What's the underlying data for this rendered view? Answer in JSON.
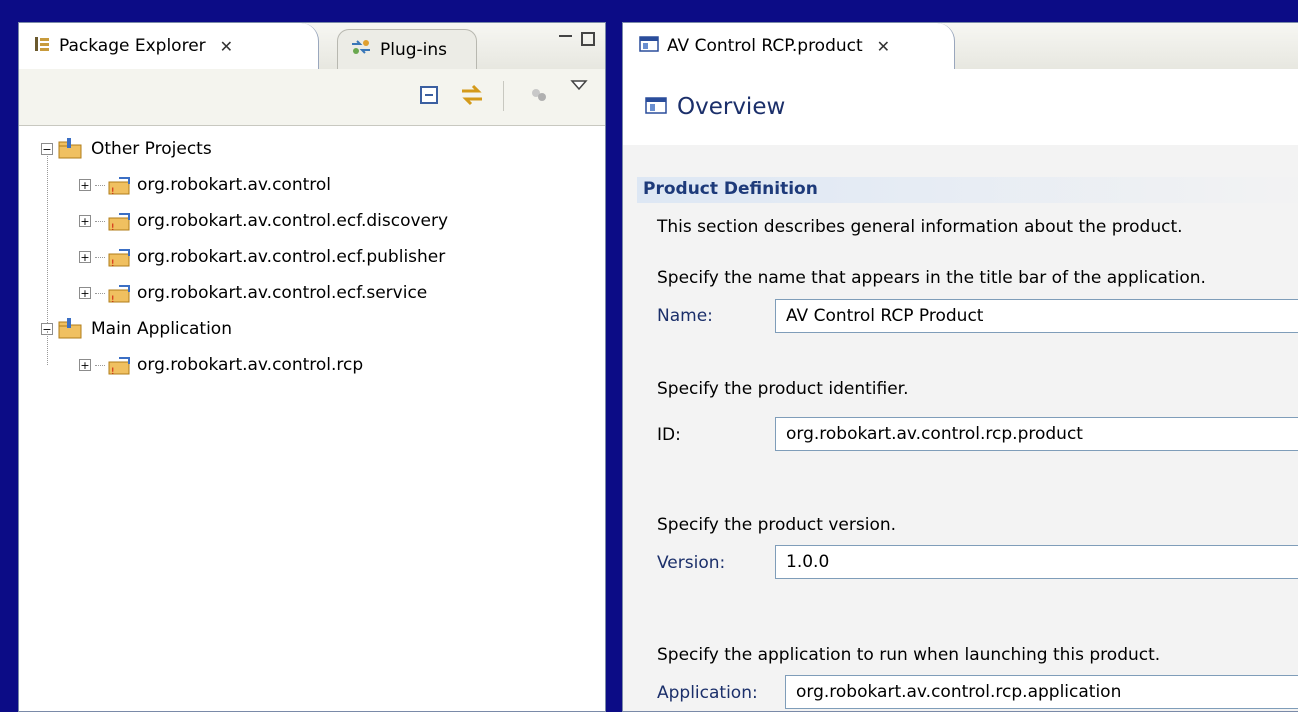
{
  "left_panel": {
    "tabs": [
      {
        "label": "Package Explorer",
        "close": "✕",
        "active": true
      },
      {
        "label": "Plug-ins",
        "active": false
      }
    ],
    "tree": {
      "groups": [
        {
          "label": "Other Projects",
          "children": [
            "org.robokart.av.control",
            "org.robokart.av.control.ecf.discovery",
            "org.robokart.av.control.ecf.publisher",
            "org.robokart.av.control.ecf.service"
          ]
        },
        {
          "label": "Main Application",
          "children": [
            "org.robokart.av.control.rcp"
          ]
        }
      ]
    }
  },
  "editor": {
    "tab": {
      "label": "AV Control RCP.product",
      "close": "✕"
    },
    "page_title": "Overview",
    "section": {
      "title": "Product Definition",
      "description": "This section describes general information about the product.",
      "name_hint": "Specify the name that appears in the title bar of the application.",
      "name_label": "Name:",
      "name_value": "AV Control RCP Product",
      "id_hint": "Specify the product identifier.",
      "id_label": "ID:",
      "id_value": "org.robokart.av.control.rcp.product",
      "version_hint": "Specify the product version.",
      "version_label": "Version:",
      "version_value": "1.0.0",
      "app_hint": "Specify the application to run when launching this product.",
      "app_label": "Application:",
      "app_value": "org.robokart.av.control.rcp.application"
    }
  },
  "colors": {
    "background": "#0c0c86",
    "heading": "#1b2f6a",
    "section_title": "#1d3a7a"
  }
}
